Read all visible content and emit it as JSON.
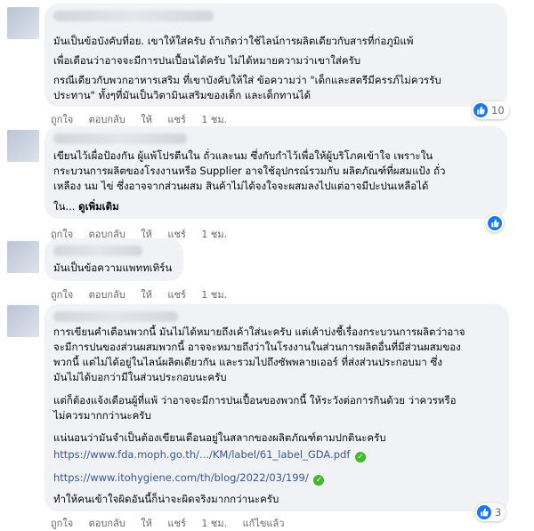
{
  "comments": [
    {
      "paragraphs": [
        "มันเป็นข้อบังคับที่อย. เขาให้ใส่ครับ ถ้าเกิดว่าใช้ไลน์การผลิตเดียวกับสารที่ก่อภูมิแพ้",
        "เพื่อเตือนว่าอาจจะมีการปนเปื้อนได้ครับ ไม่ได้หมายความว่าเขาใส่ครับ",
        "กรณีเดียวกับพวกอาหารเสริม ที่เขาบังคับให้ใส่ ข้อความว่า \"เด็กและสตรีมีครรภ์ไม่ควรรับ",
        "ประทาน\" ทั้งๆที่มันเป็นวิตามินเสริมของเด็ก และเด็กทานได้"
      ],
      "actions": {
        "like": "ถูกใจ",
        "reply": "ตอบกลับ",
        "give": "ให้",
        "share": "แชร์",
        "time": "1 ชม."
      },
      "like_count": "10"
    },
    {
      "paragraphs": [
        "เขียนไว้เผื่อป้องกัน ผู้แพ้โปรตีนใน ถั่วและนม ซึ่งกับกำไว้เพื่อให้ผู้บริโภคเข้าใจ เพราะใน",
        "กระบวนการผลิตของโรงงานหรือ Supplier อาจใช้อุปกรณ์รวมกับ ผลิตภัณฑ์ที่ผสมแป้ง ถั่ว",
        "เหลือง นม ไข่ ซึ่งอาจจากส่วนผสม สินค้าไม่ได้จงใจจะผสมลงไปแต่อาจมีปะปนเหลือได้"
      ],
      "truncated": "ใน...",
      "see_more": "ดูเพิ่มเติม",
      "actions": {
        "like": "ถูกใจ",
        "reply": "ตอบกลับ",
        "give": "ให้",
        "share": "แชร์",
        "time": "1 ชม."
      },
      "like_count": ""
    },
    {
      "paragraphs": [
        "มันเป็นข้อความแพททเทิร์น"
      ],
      "actions": {
        "like": "ถูกใจ",
        "reply": "ตอบกลับ",
        "give": "ให้",
        "share": "แชร์",
        "time": "1 ชม."
      }
    },
    {
      "paragraphs": [
        "การเขียนคำเตือนพวกนี้ มันไม่ได้หมายถึงเค้าใส่นะครับ แต่เค้าบ่งชี้เรื่องกระบวนการผลิตว่าอาจ",
        "จะมีการปนของส่วนผสมพวกนี้ อาจจะหมายถึงว่าในโรงงานในส่วนการผลิตอื่นที่มีส่วนผสมของ",
        "พวกนี้ แต่ไม่ได้อยู่ในไลน์ผลิตเดียวกัน และรวมไปถึงซัพพลายเออร์ ที่ส่งส่วนประกอบมา ซึ่ง",
        "มันไม่ได้บอกว่ามีในส่วนประกอบนะครับ",
        "แต่ก็ต้องแจ้งเตือนผู้ที่แพ้ ว่าอาจจะมีการปนเปื้อนของพวกนี้ ให้ระวังต่อการกินด้วย ว่าควรหรือ",
        "ไม่ควรมากกว่านะครับ",
        "แน่นอนว่ามันจำเป็นต้องเขียนเตือนอยู่ในสลากของผลิตภัณฑ์ตามปกตินะครับ",
        "ทำให้คนเข้าใจผิดอันนี้ก็น่าจะผิดจริงมากกว่านะครับ"
      ],
      "links": [
        "https://www.fda.moph.go.th/.../KM/label/61_label_GDA.pdf",
        "https://www.itohygiene.com/th/blog/2022/03/199/"
      ],
      "actions": {
        "like": "ถูกใจ",
        "reply": "ตอบกลับ",
        "give": "ให้",
        "share": "แชร์",
        "time": "1 ชม.",
        "edited": "แก้ไขแล้ว"
      },
      "like_count": "3"
    }
  ],
  "colors": {
    "accent": "#1877f2",
    "bubble": "#f0f2f5",
    "link": "#385898",
    "meta": "#65676b"
  },
  "icons": {
    "like": "thumbs-up-icon",
    "verified": "check-circle-icon"
  }
}
